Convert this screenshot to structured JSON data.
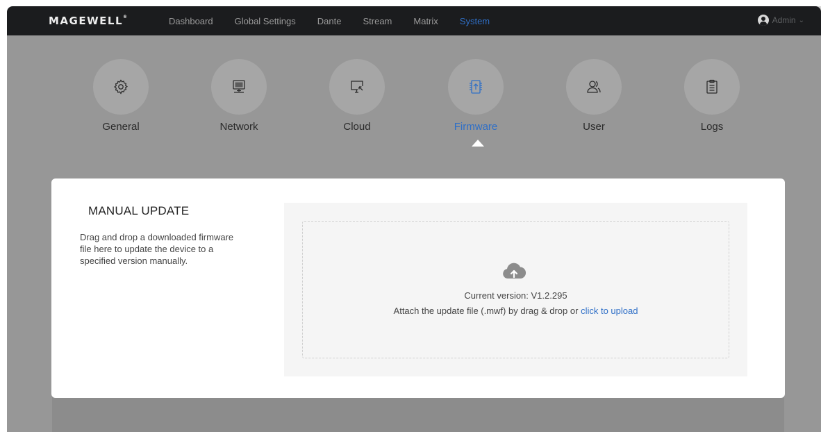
{
  "header": {
    "logo_text": "MAGEWELL",
    "logo_mark": "®",
    "nav": [
      {
        "label": "Dashboard",
        "active": false
      },
      {
        "label": "Global Settings",
        "active": false
      },
      {
        "label": "Dante",
        "active": false
      },
      {
        "label": "Stream",
        "active": false
      },
      {
        "label": "Matrix",
        "active": false
      },
      {
        "label": "System",
        "active": true
      }
    ],
    "user": {
      "name": "Admin",
      "icon": "user-avatar-icon",
      "chevron": "chevron-down-icon"
    }
  },
  "system_tabs": [
    {
      "label": "General",
      "icon": "gear-icon",
      "active": false
    },
    {
      "label": "Network",
      "icon": "monitor-network-icon",
      "active": false
    },
    {
      "label": "Cloud",
      "icon": "cloud-monitor-icon",
      "active": false
    },
    {
      "label": "Firmware",
      "icon": "firmware-chip-icon",
      "active": true
    },
    {
      "label": "User",
      "icon": "users-icon",
      "active": false
    },
    {
      "label": "Logs",
      "icon": "clipboard-icon",
      "active": false
    }
  ],
  "manual_update": {
    "title": "MANUAL UPDATE",
    "description": "Drag and drop a downloaded firmware file here to update the device to a specified version manually.",
    "dropzone": {
      "icon": "cloud-upload-icon",
      "current_version": "Current version: V1.2.295",
      "attach_text": "Attach the update file (.mwf) by drag & drop or ",
      "link_text": "click to upload"
    }
  },
  "colors": {
    "topbar": "#1b1c1e",
    "accent": "#2f6fc7",
    "overlay": "#979797",
    "modal": "#ffffff"
  }
}
